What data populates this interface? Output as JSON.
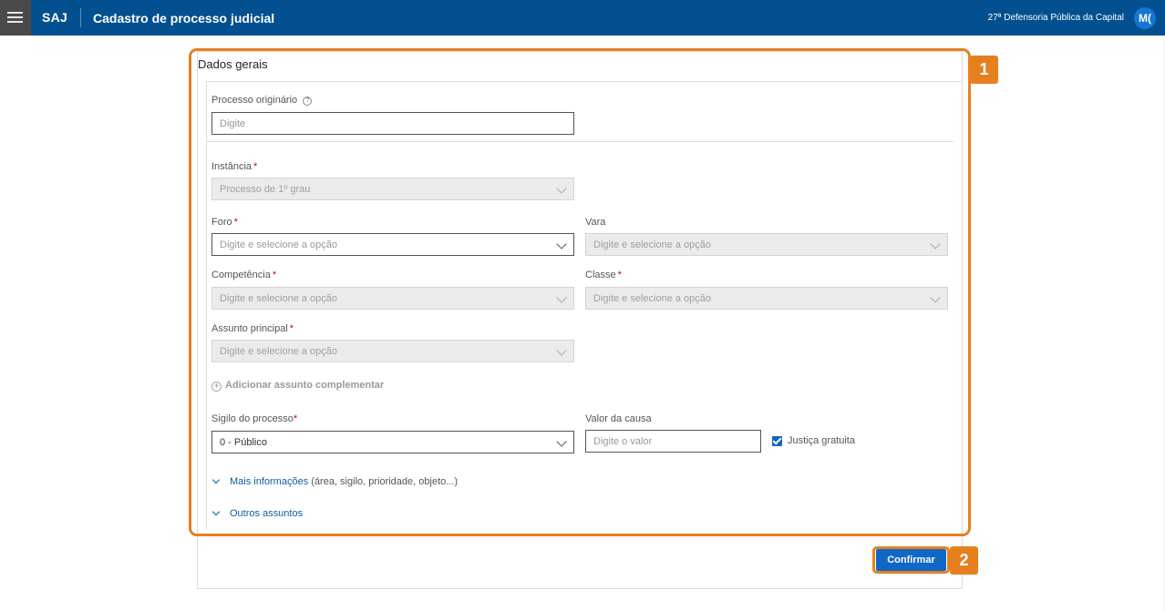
{
  "header": {
    "brand": "SAJ",
    "title": "Cadastro de processo judicial",
    "office": "27ª Defensoria Pública da Capital",
    "avatar_initials": "M(",
    "bar_color": "#02508f"
  },
  "section": {
    "title": "Dados gerais"
  },
  "form": {
    "processo_originario": {
      "label": "Processo originário",
      "placeholder": "Digite"
    },
    "instancia": {
      "label": "Instância",
      "required": "*",
      "value": "Processo de 1º grau"
    },
    "foro": {
      "label": "Foro",
      "required": "*",
      "placeholder": "Digite e selecione a opção"
    },
    "vara": {
      "label": "Vara",
      "placeholder": "Digite e selecione a opção"
    },
    "competencia": {
      "label": "Competência",
      "required": "*",
      "placeholder": "Digite e selecione a opção"
    },
    "classe": {
      "label": "Classe",
      "required": "*",
      "placeholder": "Digite e selecione a opção"
    },
    "assunto_principal": {
      "label": "Assunto principal",
      "required": "*",
      "placeholder": "Digite e selecione a opção"
    },
    "add_assunto": "Adicionar assunto complementar",
    "sigilo": {
      "label": "Sigilo do processo",
      "required": "*",
      "value": "0 - Público"
    },
    "valor_causa": {
      "label": "Valor da causa",
      "placeholder": "Digite o valor"
    },
    "justica_gratuita": {
      "label": "Justiça gratuita",
      "checked": true
    }
  },
  "expanders": {
    "mais_informacoes": {
      "label": "Mais informações",
      "hint": "(área, sigilo, prioridade, objeto...)"
    },
    "outros_assuntos": {
      "label": "Outros assuntos"
    }
  },
  "actions": {
    "confirm": "Confirmar"
  },
  "annotations": {
    "step1": "1",
    "step2": "2",
    "highlight_color": "#e6801e"
  }
}
